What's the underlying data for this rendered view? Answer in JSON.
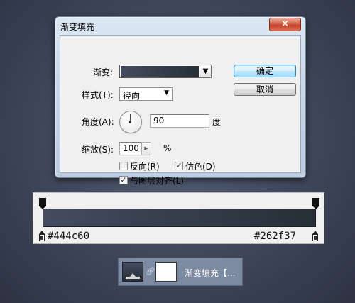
{
  "dialog": {
    "title": "渐变填充",
    "close_icon": "×",
    "gradient_label": "渐变:",
    "style_label": "样式(T):",
    "style_value": "径向",
    "angle_label": "角度(A):",
    "angle_value": "90",
    "angle_unit": "度",
    "scale_label": "缩放(S):",
    "scale_value": "100",
    "scale_unit": "%",
    "reverse_label": "反向(R)",
    "reverse_checked": false,
    "dither_label": "仿色(D)",
    "dither_checked": true,
    "align_label": "与图层对齐(L)",
    "align_checked": true,
    "ok_label": "确定",
    "cancel_label": "取消",
    "gradient_colors": [
      "#444c60",
      "#262f37"
    ]
  },
  "gradient_editor": {
    "left_color": "#444c60",
    "right_color": "#262f37"
  },
  "layer": {
    "name": "渐变填充【..."
  },
  "colors": {
    "background": "#3e4659",
    "gradient_start": "#444c60",
    "gradient_end": "#262f37",
    "close_button": "#c4412a",
    "default_button_border": "#3c7fb1"
  }
}
